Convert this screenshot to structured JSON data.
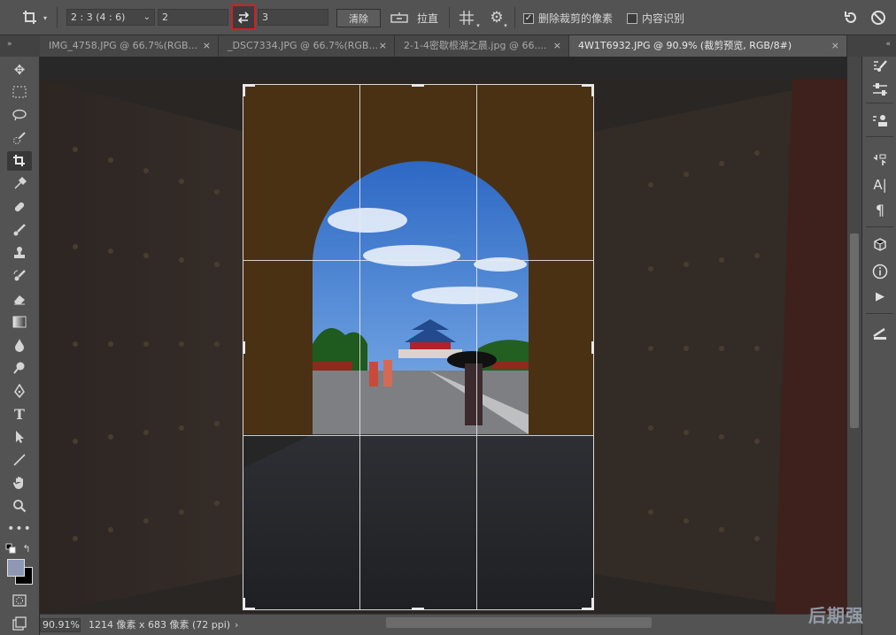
{
  "options_bar": {
    "ratio_select": "2 : 3 (4 : 6)",
    "width_value": "2",
    "height_value": "3",
    "clear_label": "清除",
    "straighten_label": "拉直",
    "delete_cropped_label": "删除裁剪的像素",
    "delete_cropped_checked": true,
    "content_aware_label": "内容识别",
    "content_aware_checked": false
  },
  "tabs": [
    {
      "label": "IMG_4758.JPG @ 66.7%(RGB...",
      "active": false
    },
    {
      "label": "_DSC7334.JPG @ 66.7%(RGB...",
      "active": false
    },
    {
      "label": "2-1-4密歇根湖之晨.jpg @ 66....",
      "active": false
    },
    {
      "label": "4W1T6932.JPG @ 90.9% (裁剪预览, RGB/8#)",
      "active": true
    }
  ],
  "tab_close_glyph": "×",
  "status_bar": {
    "zoom": "90.91%",
    "doc_info": "1214 像素 x 683 像素 (72 ppi)",
    "arrow": "›"
  },
  "watermark": "后期强",
  "colors": {
    "highlight_red": "#d51d26",
    "foreground_swatch": "#8e98b4",
    "background_swatch": "#000000"
  },
  "tools": [
    "move-icon",
    "marquee-icon",
    "lasso-icon",
    "quick-select-icon",
    "crop-icon",
    "eyedropper-icon",
    "healing-icon",
    "brush-icon",
    "stamp-icon",
    "history-brush-icon",
    "eraser-icon",
    "gradient-icon",
    "blur-icon",
    "dodge-icon",
    "pen-icon",
    "type-icon",
    "path-select-icon",
    "line-icon",
    "hand-icon",
    "zoom-icon",
    "more-icon"
  ]
}
